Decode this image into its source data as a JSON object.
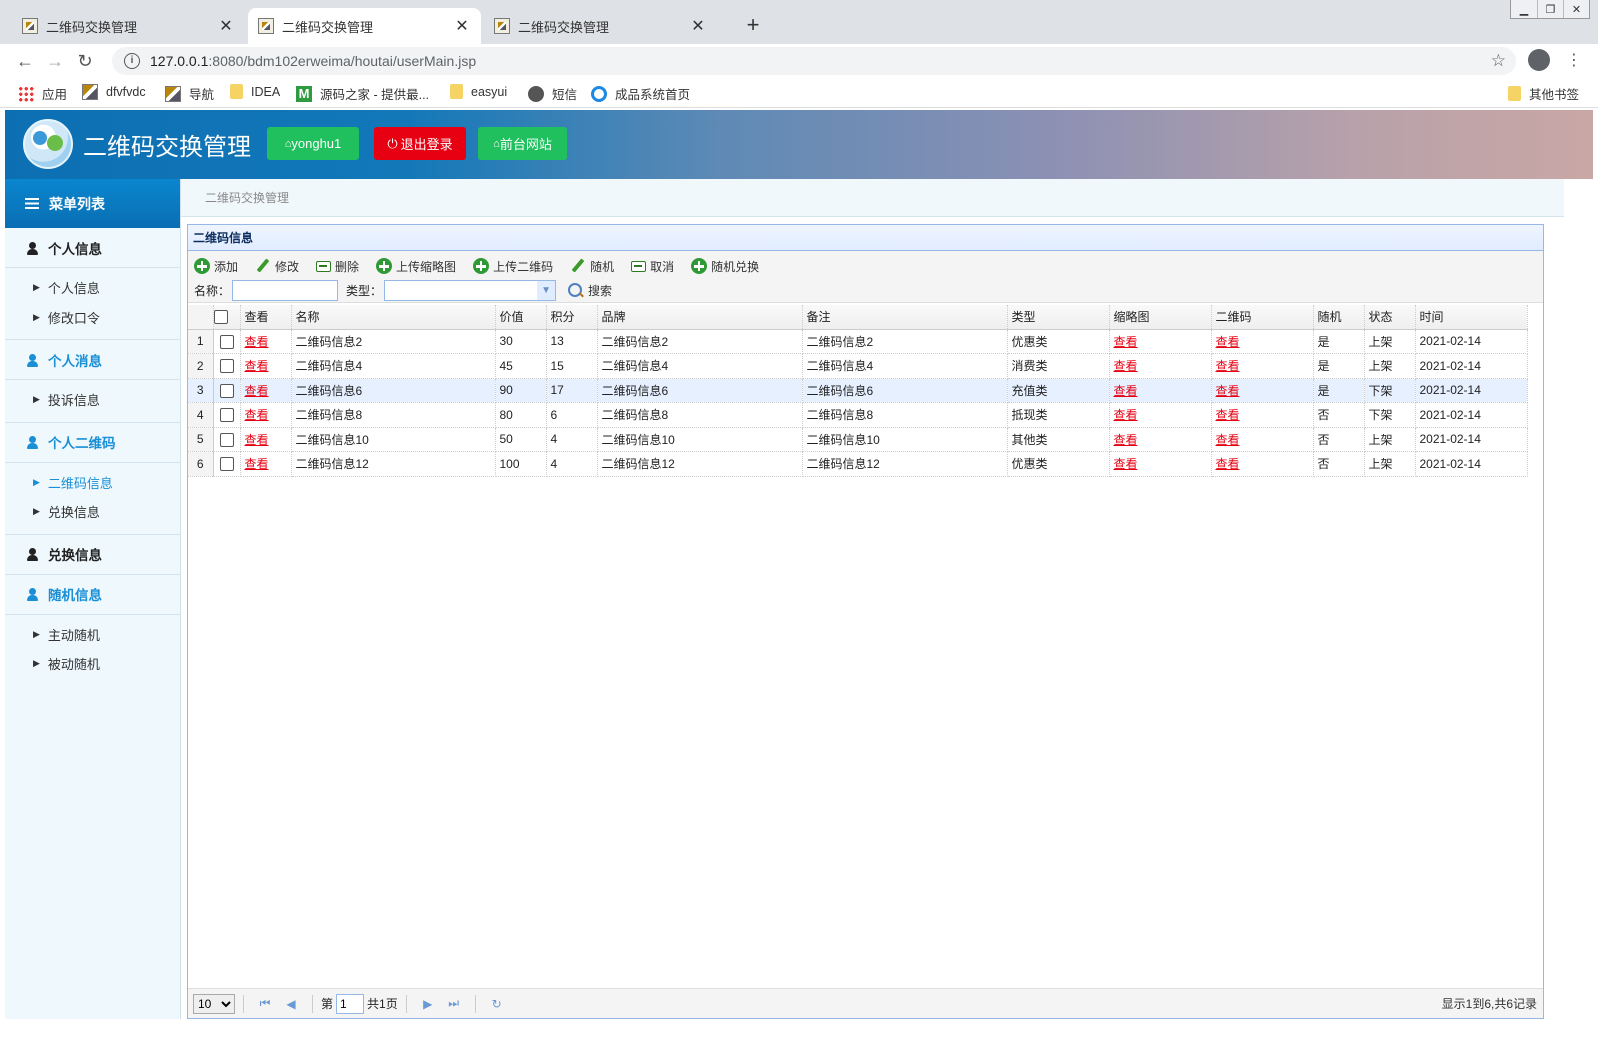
{
  "browser": {
    "tabs": [
      {
        "title": "二维码交换管理",
        "active": false
      },
      {
        "title": "二维码交换管理",
        "active": true
      },
      {
        "title": "二维码交换管理",
        "active": false
      }
    ],
    "url_host": "127.0.0.1",
    "url_path": ":8080/bdm102erweima/houtai/userMain.jsp",
    "bookmarks": [
      "应用",
      "dfvfvdc",
      "导航",
      "IDEA",
      "源码之家 - 提供最...",
      "easyui",
      "短信",
      "成品系统首页"
    ],
    "other_bookmarks": "其他书签"
  },
  "header": {
    "title": "二维码交换管理",
    "user_button": "yonghu1",
    "logout_button": "退出登录",
    "frontend_button": "前台网站"
  },
  "sidebar": {
    "title": "菜单列表",
    "sections": [
      {
        "label": "个人信息",
        "color": "#222222",
        "items": [
          "个人信息",
          "修改口令"
        ]
      },
      {
        "label": "个人消息",
        "color": "#1a8fd6",
        "items": [
          "投诉信息"
        ]
      },
      {
        "label": "个人二维码",
        "color": "#1a8fd6",
        "items": [
          "二维码信息",
          "兑换信息"
        ],
        "active_item": 0
      },
      {
        "label": "兑换信息",
        "color": "#222222",
        "items": []
      },
      {
        "label": "随机信息",
        "color": "#1a8fd6",
        "items": [
          "主动随机",
          "被动随机"
        ]
      }
    ]
  },
  "breadcrumb": "二维码交换管理",
  "panel": {
    "title": "二维码信息",
    "toolbar": {
      "buttons": [
        {
          "label": "添加",
          "icon": "plus-icon"
        },
        {
          "label": "修改",
          "icon": "pencil-icon"
        },
        {
          "label": "删除",
          "icon": "minus-icon"
        },
        {
          "label": "上传缩略图",
          "icon": "plus-icon"
        },
        {
          "label": "上传二维码",
          "icon": "plus-icon"
        },
        {
          "label": "随机",
          "icon": "pencil-icon"
        },
        {
          "label": "取消",
          "icon": "minus-icon"
        },
        {
          "label": "随机兑换",
          "icon": "plus-icon"
        }
      ],
      "name_label": "名称：",
      "name_value": "",
      "type_label": "类型：",
      "type_value": "",
      "search_label": "搜索"
    },
    "table": {
      "columns": [
        "查看",
        "名称",
        "价值",
        "积分",
        "品牌",
        "备注",
        "类型",
        "缩略图",
        "二维码",
        "随机",
        "状态",
        "时间"
      ],
      "rows": [
        [
          "1",
          "查看",
          "二维码信息2",
          "30",
          "13",
          "二维码信息2",
          "二维码信息2",
          "优惠类",
          "查看",
          "查看",
          "是",
          "上架",
          "2021-02-14"
        ],
        [
          "2",
          "查看",
          "二维码信息4",
          "45",
          "15",
          "二维码信息4",
          "二维码信息4",
          "消费类",
          "查看",
          "查看",
          "是",
          "上架",
          "2021-02-14"
        ],
        [
          "3",
          "查看",
          "二维码信息6",
          "90",
          "17",
          "二维码信息6",
          "二维码信息6",
          "充值类",
          "查看",
          "查看",
          "是",
          "下架",
          "2021-02-14"
        ],
        [
          "4",
          "查看",
          "二维码信息8",
          "80",
          "6",
          "二维码信息8",
          "二维码信息8",
          "抵现类",
          "查看",
          "查看",
          "否",
          "下架",
          "2021-02-14"
        ],
        [
          "5",
          "查看",
          "二维码信息10",
          "50",
          "4",
          "二维码信息10",
          "二维码信息10",
          "其他类",
          "查看",
          "查看",
          "否",
          "上架",
          "2021-02-14"
        ],
        [
          "6",
          "查看",
          "二维码信息12",
          "100",
          "4",
          "二维码信息12",
          "二维码信息12",
          "优惠类",
          "查看",
          "查看",
          "否",
          "上架",
          "2021-02-14"
        ]
      ],
      "selected_row": 2,
      "link_color": "#e60012"
    },
    "pager": {
      "page_size": "10",
      "page_prefix": "第",
      "page_value": "1",
      "page_suffix": "共1页",
      "info": "显示1到6,共6记录"
    }
  }
}
